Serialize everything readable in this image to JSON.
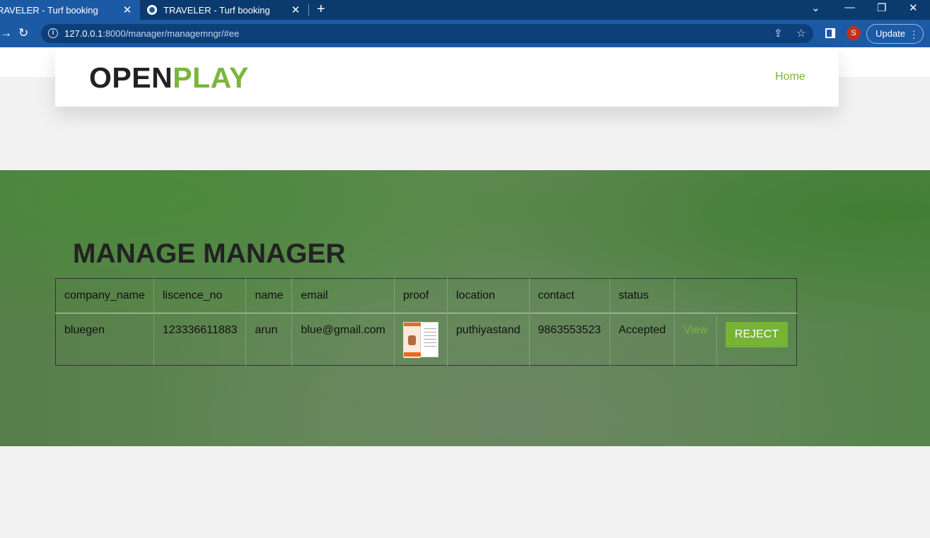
{
  "browser": {
    "tabs": [
      {
        "title": "TRAVELER - Turf booking",
        "active": true
      },
      {
        "title": "TRAVELER - Turf booking",
        "active": false
      }
    ],
    "url_host": "127.0.0.1",
    "url_rest": ":8000/manager/managemngr/#ee",
    "profile_initial": "S",
    "update_label": "Update"
  },
  "site": {
    "logo_part1": "OPEN",
    "logo_part2": "PLAY",
    "nav_home": "Home",
    "accent_color": "#7ab53c"
  },
  "page": {
    "title": "MANAGE MANAGER"
  },
  "table": {
    "headers": [
      "company_name",
      "liscence_no",
      "name",
      "email",
      "proof",
      "location",
      "contact",
      "status",
      ""
    ],
    "rows": [
      {
        "company_name": "bluegen",
        "liscence_no": "123336611883",
        "name": "arun",
        "email": "blue@gmail.com",
        "location": "puthiyastand",
        "contact": "9863553523",
        "status": "Accepted",
        "view_label": "View",
        "reject_label": "REJECT"
      }
    ]
  }
}
